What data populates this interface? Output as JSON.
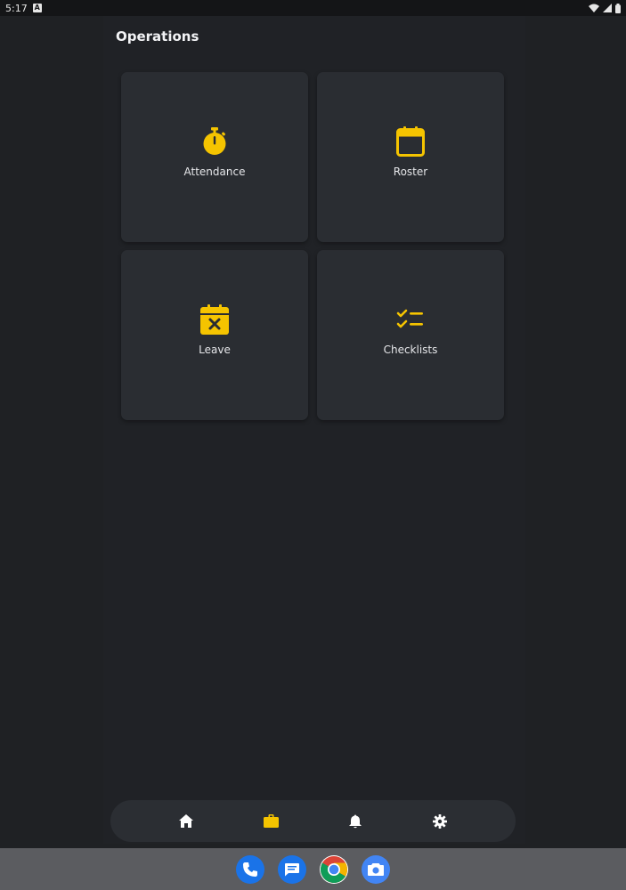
{
  "status_bar": {
    "time": "5:17",
    "notification_icon": "a-box-icon",
    "icons": [
      "wifi-icon",
      "signal-icon",
      "battery-icon"
    ]
  },
  "page": {
    "title": "Operations"
  },
  "tiles": [
    {
      "label": "Attendance",
      "icon": "stopwatch-icon"
    },
    {
      "label": "Roster",
      "icon": "calendar-icon"
    },
    {
      "label": "Leave",
      "icon": "calendar-x-icon"
    },
    {
      "label": "Checklists",
      "icon": "checklist-icon"
    }
  ],
  "bottom_nav": {
    "items": [
      {
        "icon": "home-icon",
        "active": false
      },
      {
        "icon": "briefcase-icon",
        "active": true
      },
      {
        "icon": "bell-icon",
        "active": false
      },
      {
        "icon": "gear-icon",
        "active": false
      }
    ]
  },
  "dock": {
    "apps": [
      "phone-icon",
      "messages-icon",
      "chrome-icon",
      "camera-icon"
    ]
  },
  "colors": {
    "accent": "#f5c400",
    "background": "#1f2124",
    "tile": "#2a2d32",
    "nav": "#2b2e33",
    "dock": "#5b5c60"
  }
}
